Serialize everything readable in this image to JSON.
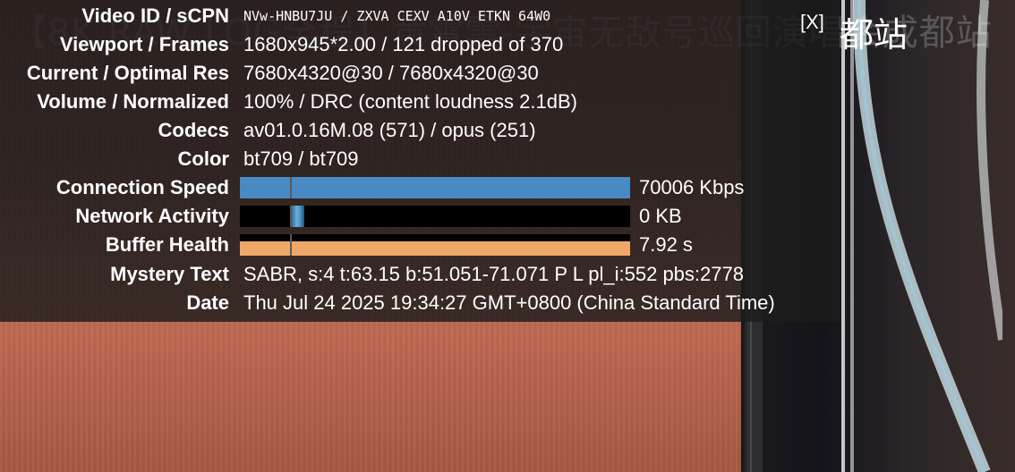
{
  "video": {
    "background_title": "【8K RAW LOG全程】黄霄雲-宇宙无敌号巡回演唱会成都站",
    "watermark": "都站"
  },
  "overlay": {
    "close_label": "[X]"
  },
  "stats": {
    "video_id": {
      "label": "Video ID / sCPN",
      "value": "NVw-HNBU7JU / ZXVA CEXV A10V ETKN 64W0"
    },
    "viewport": {
      "label": "Viewport / Frames",
      "value": "1680x945*2.00 / 121 dropped of 370"
    },
    "resolution": {
      "label": "Current / Optimal Res",
      "value": "7680x4320@30 / 7680x4320@30"
    },
    "volume": {
      "label": "Volume / Normalized",
      "value": "100% / DRC (content loudness 2.1dB)"
    },
    "codecs": {
      "label": "Codecs",
      "value": "av01.0.16M.08 (571) / opus (251)"
    },
    "color": {
      "label": "Color",
      "value": "bt709 / bt709"
    },
    "connection_speed": {
      "label": "Connection Speed",
      "value": "70006 Kbps",
      "bar_fraction": 1.0,
      "bar_color": "#4a8ac4"
    },
    "network_activity": {
      "label": "Network Activity",
      "value": "0 KB",
      "bar_color": "#000000"
    },
    "buffer_health": {
      "label": "Buffer Health",
      "value": "7.92 s",
      "bar_fraction": 1.0,
      "bar_color": "#f0a868"
    },
    "mystery_text": {
      "label": "Mystery Text",
      "value": "SABR, s:4 t:63.15 b:51.051-71.071 P L pl_i:552 pbs:2778"
    },
    "date": {
      "label": "Date",
      "value": "Thu Jul 24 2025 19:34:27 GMT+0800 (China Standard Time)"
    }
  }
}
